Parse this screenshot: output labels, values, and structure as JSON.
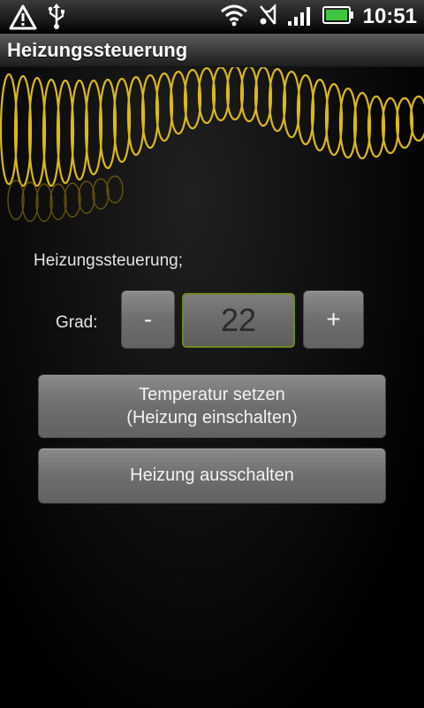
{
  "status_bar": {
    "time": "10:51",
    "icons": [
      "alert-icon",
      "usb-icon",
      "wifi-icon",
      "muted-speaker-icon",
      "signal-icon",
      "battery-icon"
    ],
    "battery_color": "#3ec63e"
  },
  "app": {
    "title": "Heizungssteuerung"
  },
  "main": {
    "header_label": "Heizungssteuerung;",
    "grad_label": "Grad:",
    "decrement_label": "-",
    "increment_label": "+",
    "temperature_value": "22",
    "set_button": {
      "line1": "Temperatur setzen",
      "line2": "(Heizung einschalten)"
    },
    "off_button_label": "Heizung ausschalten"
  },
  "colors": {
    "accent_green": "#6c8a1f",
    "wallpaper_yellow": "#e6c21a"
  }
}
